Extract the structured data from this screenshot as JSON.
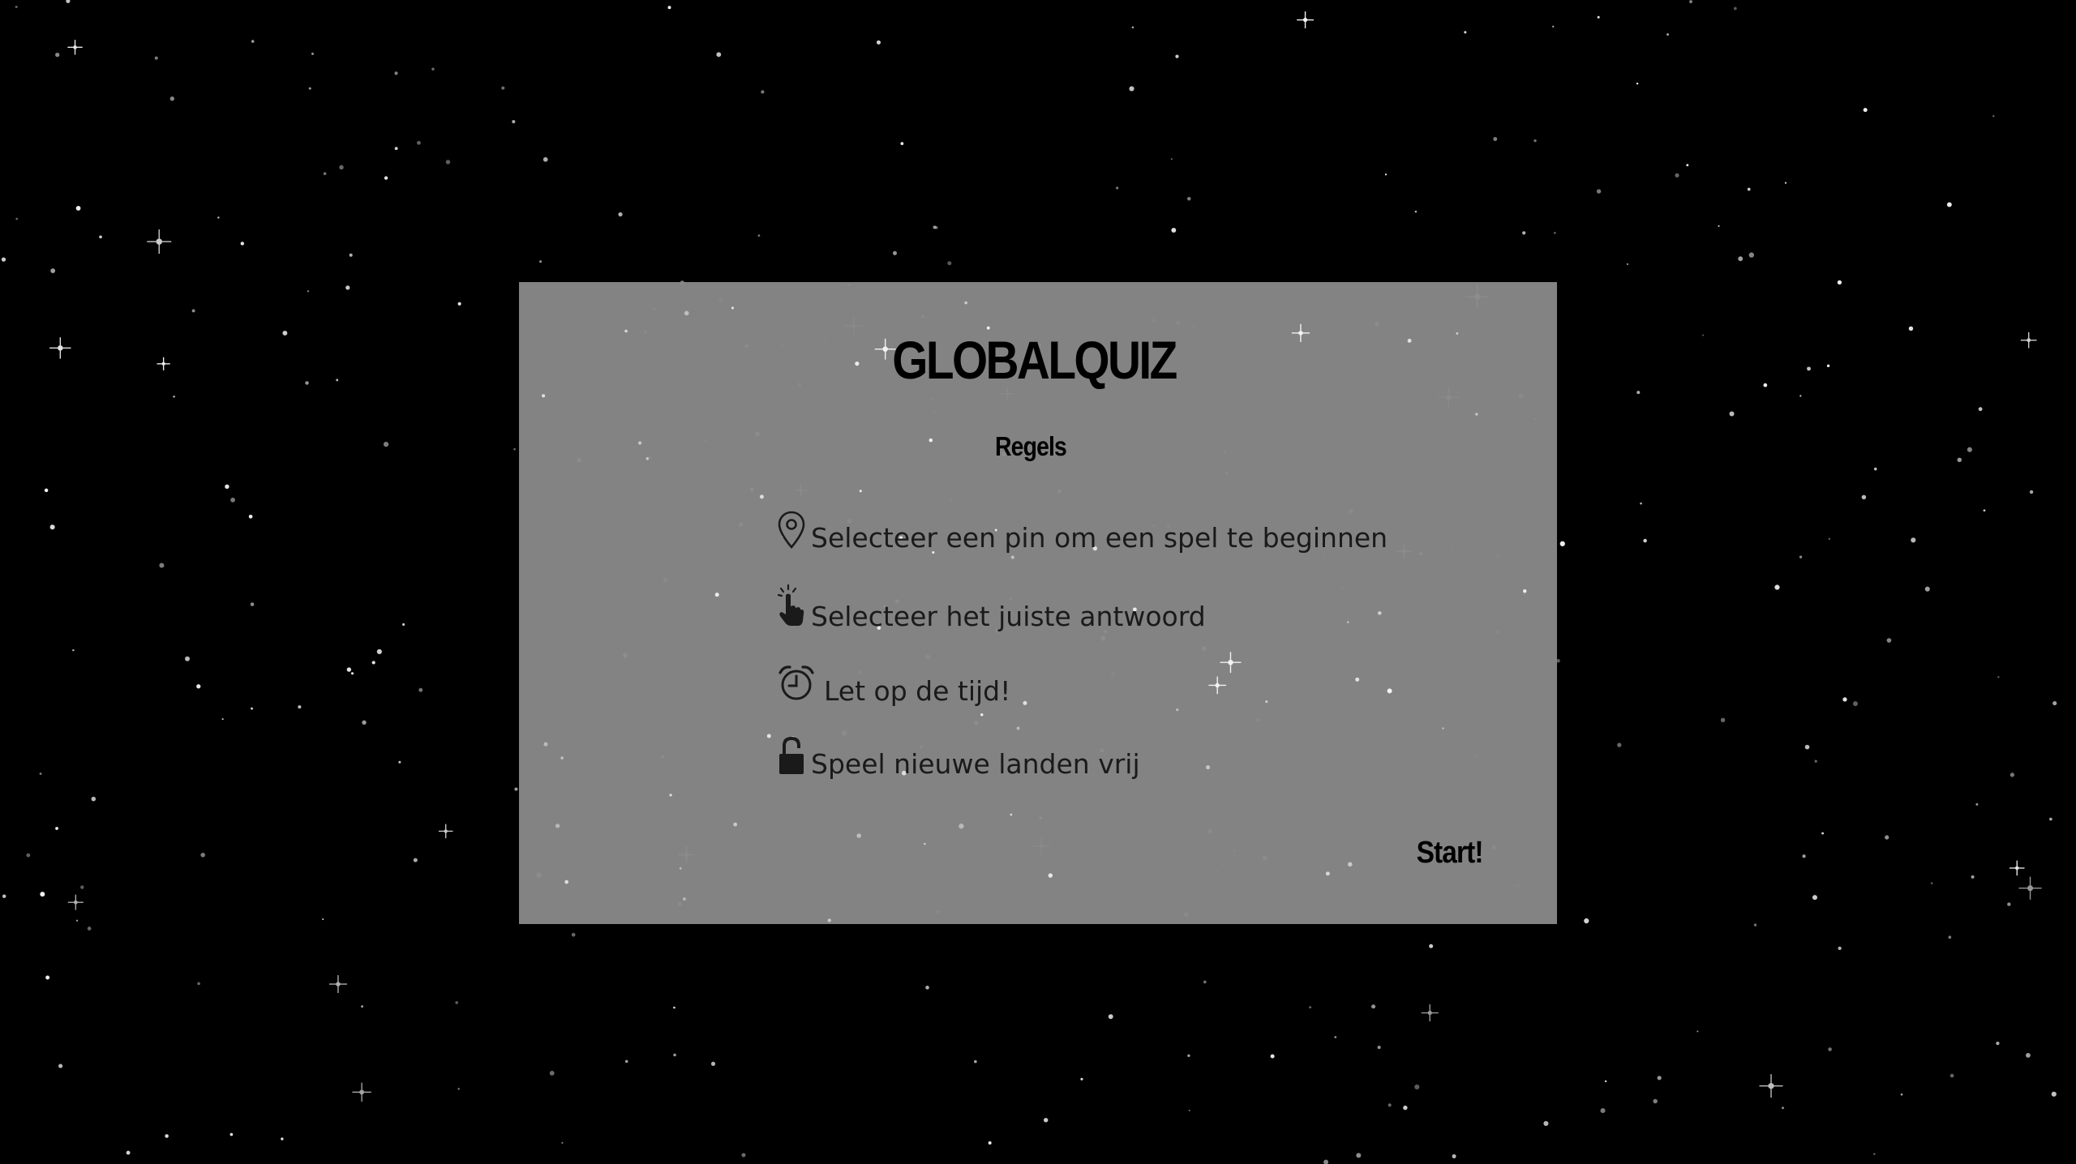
{
  "panel": {
    "title": "GLOBALQUIZ",
    "subtitle": "Regels",
    "rules": [
      {
        "icon": "map-pin-icon",
        "text": "Selecteer een pin om een spel te beginnen"
      },
      {
        "icon": "pointing-hand-icon",
        "text": "Selecteer het juiste antwoord"
      },
      {
        "icon": "alarm-clock-icon",
        "text": "Let op de tijd!"
      },
      {
        "icon": "unlocked-padlock-icon",
        "text": "Speel nieuwe landen vrij"
      }
    ],
    "start_label": "Start!"
  },
  "colors": {
    "background": "#000000",
    "panel": "#888888",
    "text": "#000000",
    "star": "#ffffff"
  }
}
